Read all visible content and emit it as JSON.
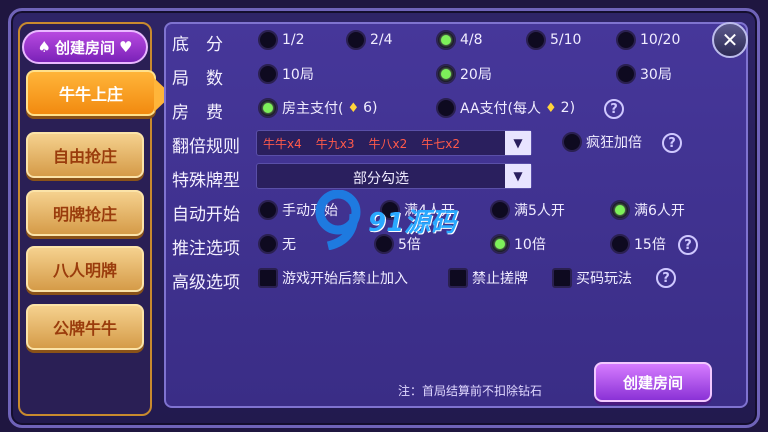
{
  "sidebar": {
    "title": "创建房间",
    "items": [
      {
        "label": "牛牛上庄",
        "active": true
      },
      {
        "label": "自由抢庄",
        "active": false
      },
      {
        "label": "明牌抢庄",
        "active": false
      },
      {
        "label": "八人明牌",
        "active": false
      },
      {
        "label": "公牌牛牛",
        "active": false
      }
    ]
  },
  "form": {
    "base_score": {
      "label": "底　分",
      "options": [
        "1/2",
        "2/4",
        "4/8",
        "5/10",
        "10/20"
      ],
      "selected": "4/8"
    },
    "rounds": {
      "label": "局　数",
      "options": [
        "10局",
        "20局",
        "30局"
      ],
      "selected": "20局"
    },
    "fee": {
      "label": "房　费",
      "owner_pay": "房主支付(",
      "owner_cost": "6)",
      "aa_pay": "AA支付(每人",
      "aa_cost": "2)",
      "selected": "owner"
    },
    "double_rule": {
      "label": "翻倍规则",
      "values": [
        "牛牛x4",
        "牛九x3",
        "牛八x2",
        "牛七x2"
      ],
      "crazy": "疯狂加倍"
    },
    "special": {
      "label": "特殊牌型",
      "value": "部分勾选"
    },
    "auto_start": {
      "label": "自动开始",
      "options": [
        "手动开始",
        "满4人开",
        "满5人开",
        "满6人开"
      ],
      "selected": "满6人开"
    },
    "push_bet": {
      "label": "推注选项",
      "options": [
        "无",
        "5倍",
        "10倍",
        "15倍"
      ],
      "selected": "10倍"
    },
    "advanced": {
      "label": "高级选项",
      "options": [
        "游戏开始后禁止加入",
        "禁止搓牌",
        "买码玩法"
      ]
    }
  },
  "note": "注：首局结算前不扣除钻石",
  "create_label": "创建房间",
  "watermark": "91源码",
  "colors": {
    "accent": "#f28a10",
    "selected": "#7df05a",
    "panel": "#46379a",
    "rule_text": "#ff5a4a"
  }
}
